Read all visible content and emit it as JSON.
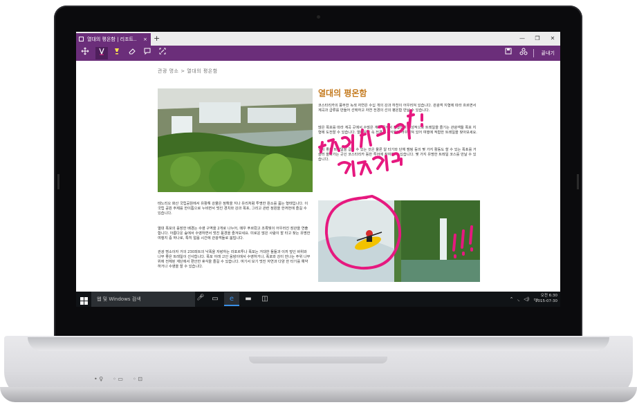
{
  "tab": {
    "title": "열대의 평온함 | 리조트..",
    "close": "×"
  },
  "new_tab": "+",
  "window": {
    "minimize": "—",
    "maximize": "❐",
    "close": "✕"
  },
  "toolbar": {
    "done_label": "끝내기"
  },
  "breadcrumb": "관광 명소 > 열대의 평온함",
  "article": {
    "title": "열대의 평온함",
    "paragraphs": [
      "코스타리카의 풍부한 녹색 자연은 수십 개의 강과 하천이 어우러져 있습니다. 관광객 지형에 따라 흐르면서 계곡과 급류를 만들어 선택하고 자연 전경의 선의 평온함 만날 수 있습니다.",
      "많은 폭포를 따라 계곡 곳에서 수많은 계곡 곳에서 진행되며 열성적으로 트레일을 즐기는 관광객들 폭포 지형에 도전할 수 있습니다. 열대우림 속 전경과 동식물이 어우러져 있어 여행에 적합한 트레일을 찾아보세요.",
      "경치 좋은 트레일을 걸을 수 있는 것은 물론 알 타기와 단체 캠핑 등의 몇 가지 활동도 할 수 있는 폭포를 거슬러 올라가는 곳인 코스타리카 동반 투어에 참여할 수 있습니다. 몇 가지 유명한 트레일 코스를 만날 수 있습니다.",
      "테노리오 화산 국립공원에서 유활해 강물은 정확을 지나 유리처럼 투명한 원소를 품는 형태입니다. 이 국립 공원 주제를 한이틈으로 누비면서 멋진 경치와 강과 폭포, 그리고 관련 정원을 한꺼번에 즐길 수 있습니다.",
      "열대 폭포의 웅장한 배경는 수영 구역을 2개로 나누어, 매우 푸르렀고 조록빛이 어우러진 장관을 연출합니다. 아름다운 숲에서 수영하면서 멋진 풍경을 즐겨보세요. 미로운 많은 사람이 할 타고 찾는 유명한 여행지 중 하나로, 특히 얼음 시간에 관광객들로 붐빕니다.",
      "관광 명소이자 거의 230피트의 낙폭을 자랑하는 라포르투나 폭포는 거대한 돌들과 이끼 덮인 바위와 나무 좋은 트레일이 선사합니다. 폭포 아래 고인 웅덩이에서 수영하거나, 폭포와 강이 만나는 주위 나무 위에 전체된 계단에서 편안한 휴식을 즐길 수 있습니다. 여기서 보기 멋진 자연과 다양 한 타기를 예약하거나 수영을 할 수 있습니다."
    ]
  },
  "taskbar": {
    "search_placeholder": "웹 및 Windows 검색",
    "clock_time": "오전 6:30",
    "clock_date": "2015-07-30"
  },
  "colors": {
    "accent": "#6b2e7a",
    "ink": "#e6197f",
    "title": "#c47a1e"
  },
  "icons": [
    "pan-icon",
    "pen-icon",
    "highlighter-icon",
    "eraser-icon",
    "comment-icon",
    "clip-icon",
    "save-icon",
    "share-icon",
    "start-icon",
    "mic-icon",
    "task-view-icon",
    "edge-icon",
    "explorer-icon",
    "store-icon"
  ]
}
